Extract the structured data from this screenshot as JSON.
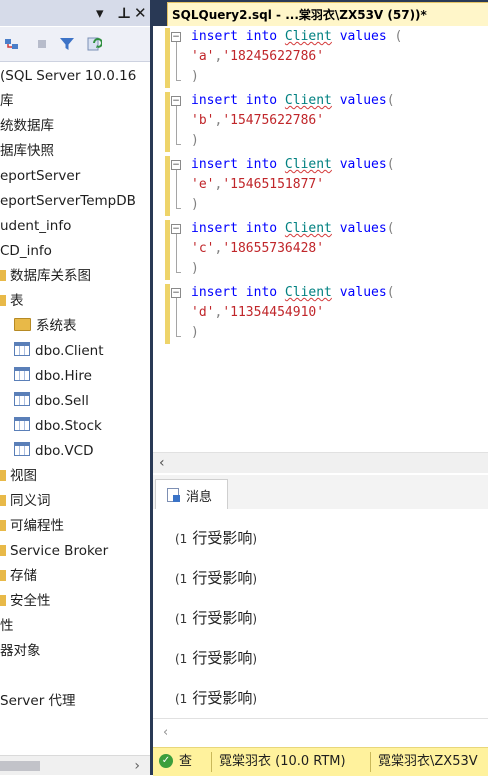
{
  "explorer": {
    "titlebar": {
      "pin_glyph": "▾",
      "pin_label": "ᵖ",
      "close_glyph": "✕"
    },
    "toolbar_icons": [
      "connect-icon",
      "stop-icon",
      "filter-icon",
      "refresh-icon"
    ],
    "tree": [
      {
        "label": "(SQL Server 10.0.16",
        "icon": "none"
      },
      {
        "label": "库",
        "icon": "none"
      },
      {
        "label": "统数据库",
        "icon": "none"
      },
      {
        "label": "据库快照",
        "icon": "none"
      },
      {
        "label": "eportServer",
        "icon": "none"
      },
      {
        "label": "eportServerTempDB",
        "icon": "none"
      },
      {
        "label": "udent_info",
        "icon": "none"
      },
      {
        "label": "CD_info",
        "icon": "none"
      },
      {
        "label": "数据库关系图",
        "icon": "half-folder"
      },
      {
        "label": "表",
        "icon": "half-folder"
      },
      {
        "label": "系统表",
        "icon": "folder"
      },
      {
        "label": "dbo.Client",
        "icon": "table"
      },
      {
        "label": "dbo.Hire",
        "icon": "table"
      },
      {
        "label": "dbo.Sell",
        "icon": "table"
      },
      {
        "label": "dbo.Stock",
        "icon": "table"
      },
      {
        "label": "dbo.VCD",
        "icon": "table"
      },
      {
        "label": "视图",
        "icon": "half-folder"
      },
      {
        "label": "同义词",
        "icon": "half-folder"
      },
      {
        "label": "可编程性",
        "icon": "half-folder"
      },
      {
        "label": "Service Broker",
        "icon": "half-folder"
      },
      {
        "label": "存储",
        "icon": "half-folder"
      },
      {
        "label": "安全性",
        "icon": "half-folder"
      },
      {
        "label": "性",
        "icon": "none"
      },
      {
        "label": "器对象",
        "icon": "none"
      },
      {
        "label": "",
        "icon": "none"
      },
      {
        "label": "Server 代理",
        "icon": "none"
      }
    ],
    "scroll_right_glyph": "›"
  },
  "editor": {
    "tab_title": "SQLQuery2.sql - ...棠羽衣\\ZX53V (57))*",
    "statements": [
      {
        "kw": "insert into",
        "table": "Client",
        "values_kw": "values",
        "open": " (",
        "code": "'a'",
        "phone": "'18245622786'",
        "close": ")"
      },
      {
        "kw": "insert into",
        "table": "Client",
        "values_kw": "values",
        "open": "(",
        "code": "'b'",
        "phone": "'15475622786'",
        "close": ")"
      },
      {
        "kw": "insert into",
        "table": "Client",
        "values_kw": "values",
        "open": "(",
        "code": "'e'",
        "phone": "'15465151877'",
        "close": ")"
      },
      {
        "kw": "insert into",
        "table": "Client",
        "values_kw": "values",
        "open": "(",
        "code": "'c'",
        "phone": "'18655736428'",
        "close": ")"
      },
      {
        "kw": "insert into",
        "table": "Client",
        "values_kw": "values",
        "open": "(",
        "code": "'d'",
        "phone": "'11354454910'",
        "close": ")"
      }
    ],
    "comma": ",",
    "scroll_left_glyph": "‹"
  },
  "results": {
    "tab_label": "消息",
    "messages": [
      {
        "open": "(1",
        "text": "行受影响",
        "close": ")"
      },
      {
        "open": "(1",
        "text": "行受影响",
        "close": ")"
      },
      {
        "open": "(1",
        "text": "行受影响",
        "close": ")"
      },
      {
        "open": "(1",
        "text": "行受影响",
        "close": ")"
      },
      {
        "open": "(1",
        "text": "行受影响",
        "close": ")"
      }
    ],
    "scroll_left_glyph": "‹"
  },
  "status": {
    "check_glyph": "✓",
    "state": "查",
    "server": "霓棠羽衣 (10.0 RTM)",
    "login": "霓棠羽衣\\ZX53V"
  }
}
